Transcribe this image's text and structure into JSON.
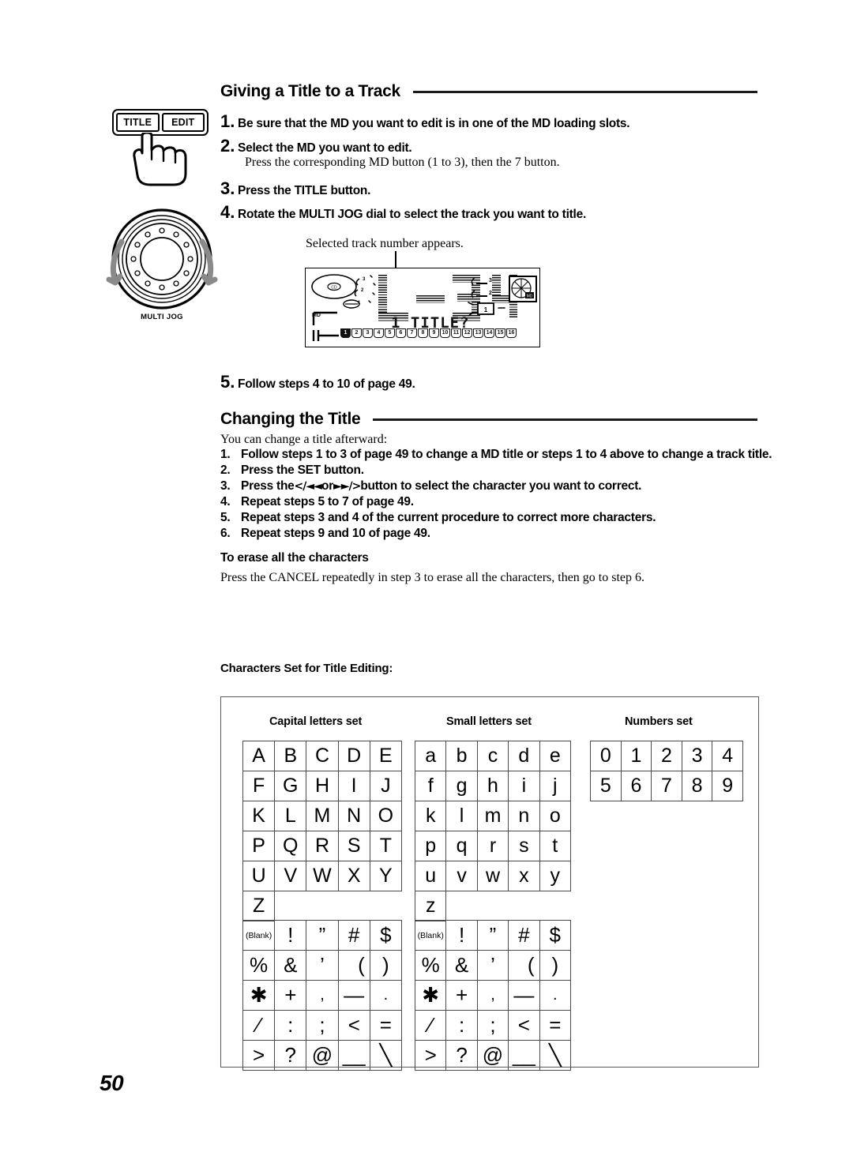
{
  "page": {
    "number": "50"
  },
  "controls": {
    "title_button": "TITLE",
    "edit_button": "EDIT",
    "jog_label": "MULTI JOG"
  },
  "section_track": {
    "heading": "Giving a Title to a Track",
    "steps": [
      {
        "num": "1.",
        "text": "Be sure that the MD you want to edit is in one of the MD loading slots."
      },
      {
        "num": "2.",
        "text": "Select the MD you want to edit."
      },
      {
        "num": "3.",
        "text": "Press the TITLE button."
      },
      {
        "num": "4.",
        "text": "Rotate the MULTI JOG dial to select the track you want to title."
      },
      {
        "num": "5.",
        "text": "Follow steps 4 to 10 of page 49."
      }
    ],
    "step2_detail": "Press the corresponding MD button (1 to 3), then the 7  button.",
    "lcd_caption": "Selected track number appears."
  },
  "lcd": {
    "big_text": "L-3",
    "title_text": "1 TITLE?",
    "md_label": "MD",
    "disc_numbers": [
      "3",
      "2",
      "1"
    ],
    "selected_disc": "1",
    "track_numbers": [
      "1",
      "2",
      "3",
      "4",
      "5",
      "6",
      "7",
      "8",
      "9",
      "10",
      "11",
      "12",
      "13",
      "14",
      "15",
      "16"
    ],
    "active_track": "1"
  },
  "section_change": {
    "heading": "Changing the Title",
    "intro": "You can change a title afterward:",
    "items": [
      {
        "num": "1.",
        "text": "Follow steps 1 to 3 of page 49 to change a MD title or steps 1 to 4 above to change a track title."
      },
      {
        "num": "2.",
        "text": "Press the SET button."
      },
      {
        "num": "3.",
        "pre": "Press the ",
        "glyph_a": "<∕◄◄",
        "mid": " or ",
        "glyph_b": "►►∕>",
        "post": " button to select the character you want to correct."
      },
      {
        "num": "4.",
        "text": "Repeat steps 5 to 7 of page 49."
      },
      {
        "num": "5.",
        "text": "Repeat steps 3 and 4 of the current procedure to correct more characters."
      },
      {
        "num": "6.",
        "text": "Repeat steps 9 and 10 of page 49."
      }
    ],
    "erase_heading": "To erase all the characters",
    "erase_text": "Press the CANCEL repeatedly in step 3 to erase all the characters, then go to step 6."
  },
  "chars_table": {
    "label": "Characters Set for Title Editing:",
    "sets": [
      {
        "title": "Capital letters set"
      },
      {
        "title": "Small letters set"
      },
      {
        "title": "Numbers set"
      }
    ],
    "capital_rows": [
      [
        "A",
        "B",
        "C",
        "D",
        "E"
      ],
      [
        "F",
        "G",
        "H",
        "I",
        "J"
      ],
      [
        "K",
        "L",
        "M",
        "N",
        "O"
      ],
      [
        "P",
        "Q",
        "R",
        "S",
        "T"
      ],
      [
        "U",
        "V",
        "W",
        "X",
        "Y"
      ],
      [
        "Z"
      ]
    ],
    "small_rows": [
      [
        "a",
        "b",
        "c",
        "d",
        "e"
      ],
      [
        "f",
        "g",
        "h",
        "i",
        "j"
      ],
      [
        "k",
        "l",
        "m",
        "n",
        "o"
      ],
      [
        "p",
        "q",
        "r",
        "s",
        "t"
      ],
      [
        "u",
        "v",
        "w",
        "x",
        "y"
      ],
      [
        "z"
      ]
    ],
    "number_rows": [
      [
        "0",
        "1",
        "2",
        "3",
        "4"
      ],
      [
        "5",
        "6",
        "7",
        "8",
        "9"
      ]
    ],
    "blank_label": "(Blank)",
    "symbol_rows": [
      [
        "(Blank)",
        "!",
        "”",
        "#",
        "$"
      ],
      [
        "%",
        "&",
        "’",
        "(",
        ")"
      ],
      [
        "✱",
        "+",
        ",",
        "—",
        "."
      ],
      [
        "∕",
        ":",
        ";",
        "<",
        "="
      ],
      [
        ">",
        "?",
        "@",
        "__",
        "╲"
      ]
    ]
  }
}
